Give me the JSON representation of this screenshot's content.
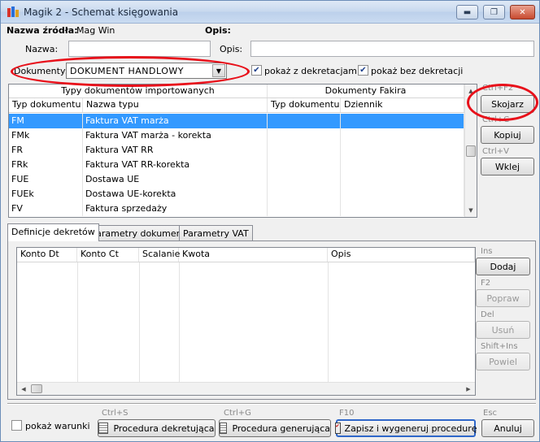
{
  "window": {
    "title": "Magik 2 - Schemat księgowania",
    "min_glyph": "▬",
    "max_glyph": "❐",
    "close_glyph": "✕"
  },
  "source": {
    "label": "Nazwa źródła:",
    "value": "Mag Win",
    "opis_label": "Opis:"
  },
  "form": {
    "nazwa_label": "Nazwa:",
    "nazwa_value": "",
    "opis_label": "Opis:",
    "opis_value": "",
    "dokumenty_label": "Dokumenty:",
    "dokumenty_value": "DOKUMENT HANDLOWY",
    "chk_z_dekretacjami": "pokaż z dekretacjami",
    "chk_bez_dekretacji": "pokaż bez dekretacji"
  },
  "doc_grid": {
    "group_left": "Typy dokumentów importowanych",
    "group_right": "Dokumenty Fakira",
    "columns": [
      "Typ dokumentu",
      "Nazwa typu",
      "Typ dokumentu",
      "Dziennik"
    ],
    "rows": [
      {
        "code": "FM",
        "name": "Faktura VAT marża"
      },
      {
        "code": "FMk",
        "name": "Faktura VAT marża - korekta"
      },
      {
        "code": "FR",
        "name": "Faktura VAT RR"
      },
      {
        "code": "FRk",
        "name": "Faktura VAT RR-korekta"
      },
      {
        "code": "FUE",
        "name": "Dostawa UE"
      },
      {
        "code": "FUEk",
        "name": "Dostawa UE-korekta"
      },
      {
        "code": "FV",
        "name": "Faktura sprzedaży"
      }
    ]
  },
  "right_actions": {
    "skojarz_shortcut": "Ctrl+F2",
    "skojarz": "Skojarz",
    "kopiuj_shortcut": "Ctrl+C",
    "kopiuj": "Kopiuj",
    "wklej_shortcut": "Ctrl+V",
    "wklej": "Wklej"
  },
  "tabs": [
    "Definicje dekretów",
    "Parametry dokumentu",
    "Parametry VAT"
  ],
  "decree_grid": {
    "columns": [
      "Konto Dt",
      "Konto Ct",
      "Scalanie",
      "Kwota",
      "Opis"
    ]
  },
  "decree_actions": {
    "dodaj_shortcut": "Ins",
    "dodaj": "Dodaj",
    "popraw_shortcut": "F2",
    "popraw": "Popraw",
    "usun_shortcut": "Del",
    "usun": "Usuń",
    "powiel_shortcut": "Shift+Ins",
    "powiel": "Powiel"
  },
  "bottom": {
    "pokaz_warunki": "pokaż warunki",
    "proc_dekret_shortcut": "Ctrl+S",
    "proc_dekret": "Procedura dekretująca",
    "proc_gen_shortcut": "Ctrl+G",
    "proc_gen": "Procedura generująca",
    "zapisz_shortcut": "F10",
    "zapisz": "Zapisz i wygeneruj procedurę",
    "anuluj_shortcut": "Esc",
    "anuluj": "Anuluj"
  },
  "colors": {
    "selection": "#3399ff",
    "annotation_red": "#e8101a"
  }
}
